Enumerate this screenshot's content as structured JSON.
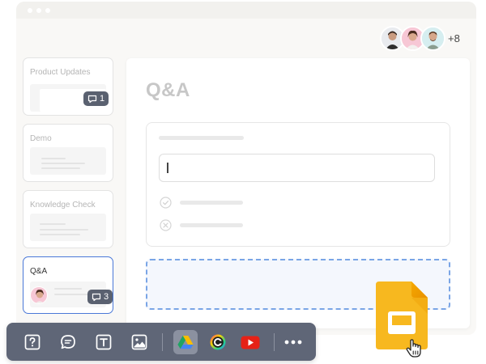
{
  "avatars": {
    "more_count": "+8",
    "people": [
      {
        "name": "avatar-1",
        "bg": "#e9ebef"
      },
      {
        "name": "avatar-2",
        "bg": "#f7c7d5"
      },
      {
        "name": "avatar-3",
        "bg": "#d6eef0"
      }
    ]
  },
  "slides": [
    {
      "title": "Product Updates",
      "comments": "1"
    },
    {
      "title": "Demo"
    },
    {
      "title": "Knowledge Check"
    },
    {
      "title": "Q&A",
      "comments": "3",
      "active": true
    }
  ],
  "main": {
    "heading": "Q&A"
  },
  "toolbar": {
    "icons": [
      "question-icon",
      "comment-icon",
      "text-icon",
      "image-icon",
      "google-drive-icon",
      "integration-icon",
      "youtube-icon",
      "more-icon"
    ],
    "selected": "google-drive-icon"
  },
  "colors": {
    "accent": "#4a78d8",
    "toolbar": "#5f6677",
    "badge": "#5a6170",
    "slides_yellow": "#f7b81f",
    "youtube_red": "#e62117"
  }
}
